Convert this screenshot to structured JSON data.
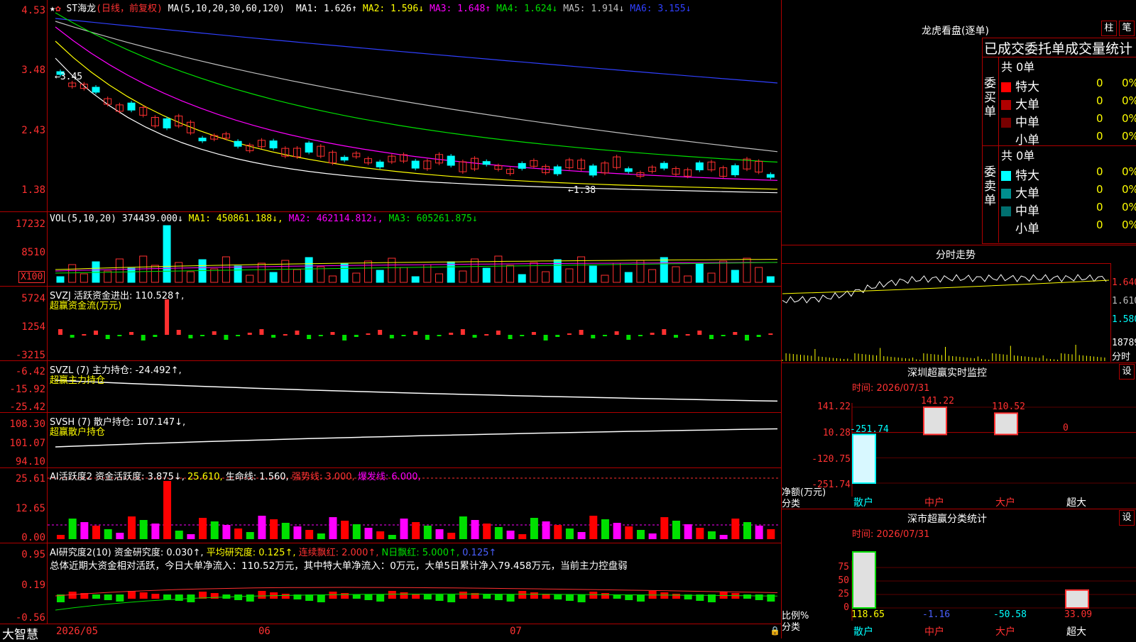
{
  "main": {
    "title": "ST海龙",
    "subtitle": "(日线，前复权)",
    "ma_prefix": "MA(5,10,20,30,60,120)",
    "ma": [
      {
        "label": "MA1: 1.626↑",
        "color": "#ffffff"
      },
      {
        "label": "MA2: 1.596↓",
        "color": "#ffff00"
      },
      {
        "label": "MA3: 1.648↑",
        "color": "#ff00ff"
      },
      {
        "label": "MA4: 1.624↓",
        "color": "#00e000"
      },
      {
        "label": "MA5: 1.914↓",
        "color": "#c0c0c0"
      },
      {
        "label": "MA6: 3.155↓",
        "color": "#3040ff"
      }
    ],
    "y_ticks": [
      "4.53",
      "3.48",
      "2.43",
      "1.38"
    ],
    "annot_high": "←3.45",
    "annot_low": "←1.38"
  },
  "vol": {
    "header": "VOL(5,10,20)  374439.000↓",
    "ma1": "MA1: 450861.188↓,",
    "ma2": "MA2: 462114.812↓,",
    "ma3": "MA3: 605261.875↓",
    "y_ticks": [
      "17232",
      "8510"
    ],
    "unit": "X100"
  },
  "svzj": {
    "header": "SVZJ  活跃资金进出: 110.528↑,",
    "sub": "超赢资金流(万元)",
    "y_ticks": [
      "5724",
      "1254",
      "-3215"
    ]
  },
  "svzl": {
    "header": "SVZL (7) 主力持仓: -24.492↑,",
    "sub": "超赢主力持仓",
    "y_ticks": [
      "-6.42",
      "-15.92",
      "-25.42"
    ]
  },
  "svsh": {
    "header": "SVSH (7) 散户持仓: 107.147↓,",
    "sub": "超赢散户持仓",
    "y_ticks": [
      "108.30",
      "101.07",
      "94.10"
    ]
  },
  "ai1": {
    "header": "AI活跃度2 资金活跃度: 3.875↓,",
    "v2": "25.610,",
    "v3": "生命线: 1.560,",
    "v4": "强势线: 3.000,",
    "v5": "爆发线: 6.000,",
    "y_ticks": [
      "25.61",
      "12.65",
      "0.00"
    ]
  },
  "ai2": {
    "header": "AI研究度2(10) 资金研究度: 0.030↑,",
    "v2": "平均研究度: 0.125↑,",
    "v3": "连续飘红: 2.000↑,",
    "v4": "N日飘红: 5.000↑,",
    "v5": "0.125↑",
    "summary": "总体近期大资金相对活跃，今日大单净流入：110.52万元，其中特大单净流入：0万元，大单5日累计净入79.458万元，当前主力控盘弱",
    "y_ticks": [
      "0.95",
      "0.19",
      "-0.56"
    ]
  },
  "bottom": {
    "logo": "大智慧",
    "dates": [
      "2026/05",
      "06",
      "07"
    ]
  },
  "right": {
    "lhb_title": "龙虎看盘(逐单)",
    "btn_zhu": "柱",
    "btn_bi": "笔",
    "stats_title": "已成交委托单成交量统计",
    "buy_label": "委买单",
    "sell_label": "委卖单",
    "buy_total": "共 0单",
    "sell_total": "共 0单",
    "buy_rows": [
      {
        "name": "特大",
        "vol": "0",
        "pct": "0%",
        "color": "#ff0000"
      },
      {
        "name": "大单",
        "vol": "0",
        "pct": "0%",
        "color": "#b00000"
      },
      {
        "name": "中单",
        "vol": "0",
        "pct": "0%",
        "color": "#780000"
      },
      {
        "name": "小单",
        "vol": "0",
        "pct": "0%",
        "color": "#000000"
      }
    ],
    "sell_rows": [
      {
        "name": "特大",
        "vol": "0",
        "pct": "0%",
        "color": "#00ffff"
      },
      {
        "name": "大单",
        "vol": "0",
        "pct": "0%",
        "color": "#008f8f"
      },
      {
        "name": "中单",
        "vol": "0",
        "pct": "0%",
        "color": "#006f6f"
      },
      {
        "name": "小单",
        "vol": "0",
        "pct": "0%",
        "color": "#000000"
      }
    ],
    "intraday_title": "分时走势",
    "intraday_ticks": [
      "1.640",
      "1.610",
      "1.580"
    ],
    "intraday_vol": "18789",
    "intraday_label": "分时",
    "monitor_title": "深圳超赢实时监控",
    "monitor_btn": "设",
    "monitor_time": "时间: 2026/07/31",
    "monitor_ticks": [
      "141.22",
      "10.28",
      "-120.75",
      "-251.74"
    ],
    "monitor_side": "净额(万元)",
    "monitor_cat": "分类",
    "class_title": "深市超赢分类统计",
    "class_btn": "设",
    "class_time": "时间: 2026/07/31",
    "class_ticks": [
      "75",
      "50",
      "25",
      "0"
    ],
    "class_side": "比例%",
    "class_cat": "分类",
    "categories": [
      "散户",
      "中户",
      "大户",
      "超大"
    ],
    "category_colors": [
      "#00ffff",
      "#ff3030",
      "#ff3030",
      "#ffffff"
    ]
  },
  "chart_data": [
    {
      "type": "bar",
      "title": "深圳超赢实时监控",
      "ylabel": "净额(万元)",
      "categories": [
        "散户",
        "中户",
        "大户",
        "超大"
      ],
      "values": [
        -251.74,
        141.22,
        110.52,
        0
      ],
      "ylim": [
        -251.74,
        141.22
      ]
    },
    {
      "type": "bar",
      "title": "深市超赢分类统计",
      "ylabel": "比例%",
      "categories": [
        "散户",
        "中户",
        "大户",
        "超大"
      ],
      "values": [
        118.65,
        -1.16,
        -50.58,
        33.09
      ],
      "ylim": [
        0,
        75
      ]
    }
  ]
}
